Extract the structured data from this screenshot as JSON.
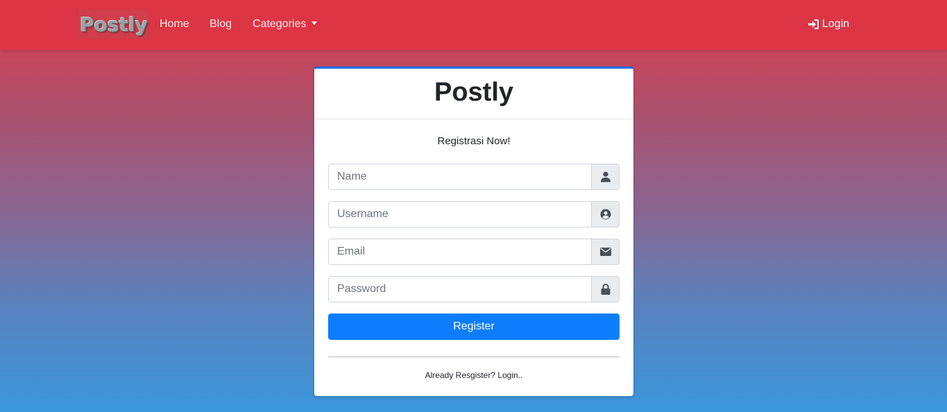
{
  "navbar": {
    "brand": "Postly",
    "links": [
      {
        "label": "Home"
      },
      {
        "label": "Blog"
      },
      {
        "label": "Categories"
      }
    ],
    "login_label": "Login",
    "background": "#dc3545"
  },
  "card": {
    "title": "Postly",
    "subtitle": "Registrasi Now!",
    "fields": {
      "name": {
        "placeholder": "Name",
        "value": "",
        "icon": "user-icon"
      },
      "username": {
        "placeholder": "Username",
        "value": "",
        "icon": "user-circle-icon"
      },
      "email": {
        "placeholder": "Email",
        "value": "",
        "icon": "envelope-icon"
      },
      "password": {
        "placeholder": "Password",
        "value": "",
        "icon": "lock-icon"
      }
    },
    "register_label": "Register",
    "footer_text": "Already Resgister? Login..",
    "accent": "#0d6efd"
  }
}
